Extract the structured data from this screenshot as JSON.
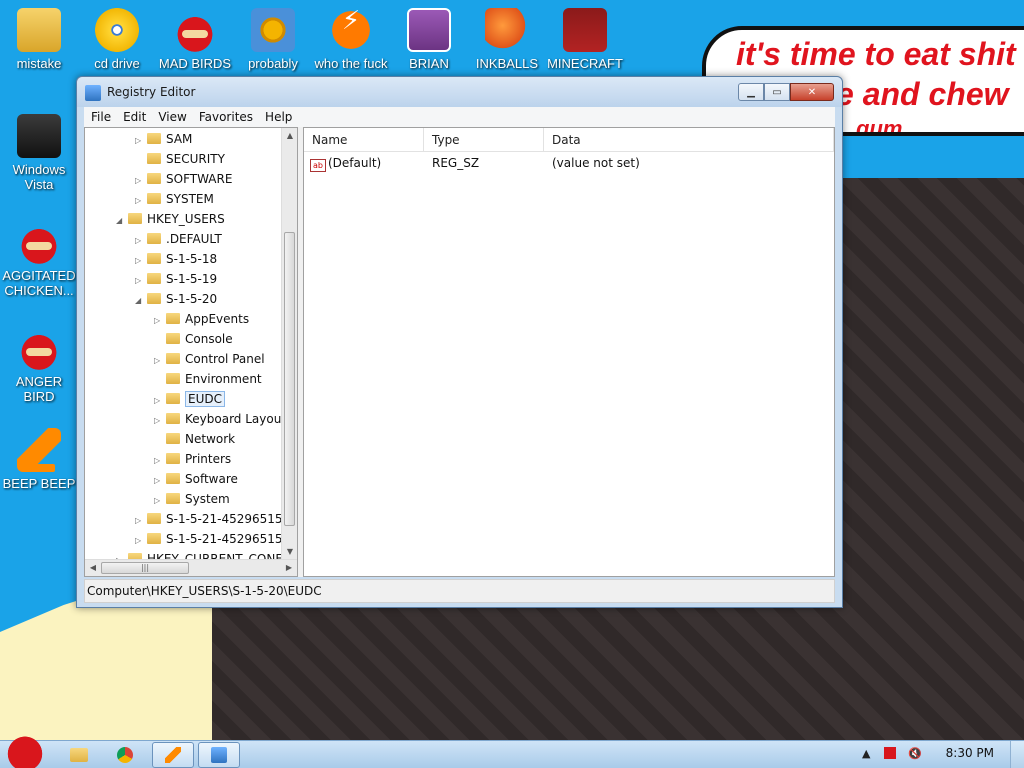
{
  "desktop": {
    "icons": [
      {
        "label": "mistake",
        "icon": "folder-app-icon"
      },
      {
        "label": "cd drive",
        "icon": "cd-icon"
      },
      {
        "label": "MAD BIRDS",
        "icon": "angry-bird-icon"
      },
      {
        "label": "probably",
        "icon": "gear-icon"
      },
      {
        "label": "who the fuck",
        "icon": "lightning-icon"
      },
      {
        "label": "BRIAN",
        "icon": "brian-icon"
      },
      {
        "label": "INKBALLS",
        "icon": "inkball-icon"
      },
      {
        "label": "MINECRAFT",
        "icon": "minecraft-icon"
      },
      {
        "label": "Windows Vista",
        "icon": "recycle-bin-icon"
      },
      {
        "label": "AGGITATED CHICKEN...",
        "icon": "angry-bird-icon"
      },
      {
        "label": "ANGER BIRD",
        "icon": "angry-bird-icon"
      },
      {
        "label": "BEEP BEEP",
        "icon": "vlc-cone-icon"
      }
    ],
    "speech_bubble": {
      "line1": "it's time to eat shit",
      "line2": "e and chew",
      "line3": "gum"
    }
  },
  "window": {
    "title": "Registry Editor",
    "menu": [
      "File",
      "Edit",
      "View",
      "Favorites",
      "Help"
    ],
    "tree": [
      {
        "label": "SAM",
        "expander": "▷",
        "selected": false
      },
      {
        "label": "SECURITY",
        "expander": "",
        "selected": false
      },
      {
        "label": "SOFTWARE",
        "expander": "▷",
        "selected": false
      },
      {
        "label": "SYSTEM",
        "expander": "▷",
        "selected": false
      },
      {
        "label": "HKEY_USERS",
        "expander": "◢",
        "selected": false
      },
      {
        "label": ".DEFAULT",
        "expander": "▷",
        "selected": false
      },
      {
        "label": "S-1-5-18",
        "expander": "▷",
        "selected": false
      },
      {
        "label": "S-1-5-19",
        "expander": "▷",
        "selected": false
      },
      {
        "label": "S-1-5-20",
        "expander": "◢",
        "selected": false
      },
      {
        "label": "AppEvents",
        "expander": "▷",
        "selected": false
      },
      {
        "label": "Console",
        "expander": "",
        "selected": false
      },
      {
        "label": "Control Panel",
        "expander": "▷",
        "selected": false
      },
      {
        "label": "Environment",
        "expander": "",
        "selected": false
      },
      {
        "label": "EUDC",
        "expander": "▷",
        "selected": true
      },
      {
        "label": "Keyboard Layou",
        "expander": "▷",
        "selected": false
      },
      {
        "label": "Network",
        "expander": "",
        "selected": false
      },
      {
        "label": "Printers",
        "expander": "▷",
        "selected": false
      },
      {
        "label": "Software",
        "expander": "▷",
        "selected": false
      },
      {
        "label": "System",
        "expander": "▷",
        "selected": false
      },
      {
        "label": "S-1-5-21-45296515",
        "expander": "▷",
        "selected": false
      },
      {
        "label": "S-1-5-21-45296515",
        "expander": "▷",
        "selected": false
      },
      {
        "label": "HKEY_CURRENT_CONF",
        "expander": "▷",
        "selected": false
      }
    ],
    "columns": [
      "Name",
      "Type",
      "Data"
    ],
    "values": [
      {
        "name": "(Default)",
        "type": "REG_SZ",
        "data": "(value not set)"
      }
    ],
    "status": "Computer\\HKEY_USERS\\S-1-5-20\\EUDC"
  },
  "taskbar": {
    "buttons": [
      "explorer-icon",
      "chrome-icon",
      "vlc-icon",
      "registry-editor-icon"
    ],
    "clock": "8:30 PM"
  }
}
